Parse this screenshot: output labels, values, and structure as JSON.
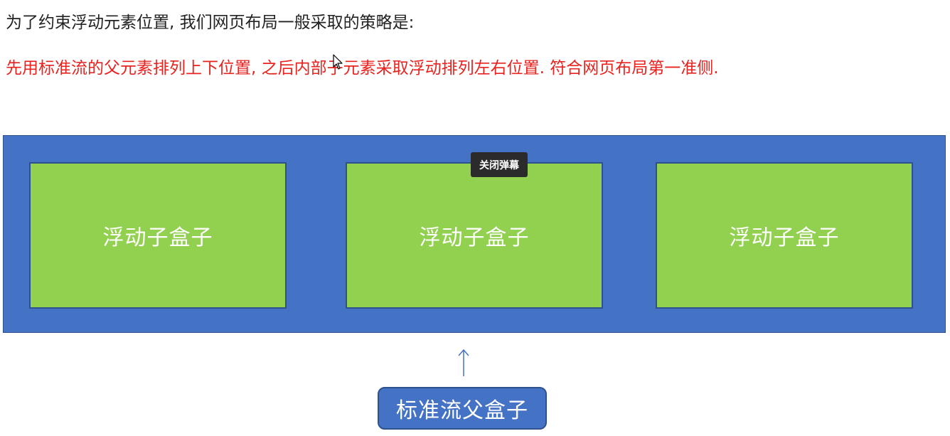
{
  "text": {
    "line1": "为了约束浮动元素位置, 我们网页布局一般采取的策略是:",
    "line2": "先用标准流的父元素排列上下位置, 之后内部子元素采取浮动排列左右位置. 符合网页布局第一准侧."
  },
  "diagram": {
    "children": [
      {
        "label": "浮动子盒子"
      },
      {
        "label": "浮动子盒子"
      },
      {
        "label": "浮动子盒子"
      }
    ],
    "parent_label": "标准流父盒子"
  },
  "overlay": {
    "close_danmaku": "关闭弹幕"
  },
  "colors": {
    "parent_fill": "#4472c4",
    "child_fill": "#92d050",
    "border": "#2f528f",
    "highlight_text": "#e8231f"
  },
  "icons": {
    "cursor": "mouse-pointer-icon",
    "arrow": "arrow-up-icon"
  }
}
